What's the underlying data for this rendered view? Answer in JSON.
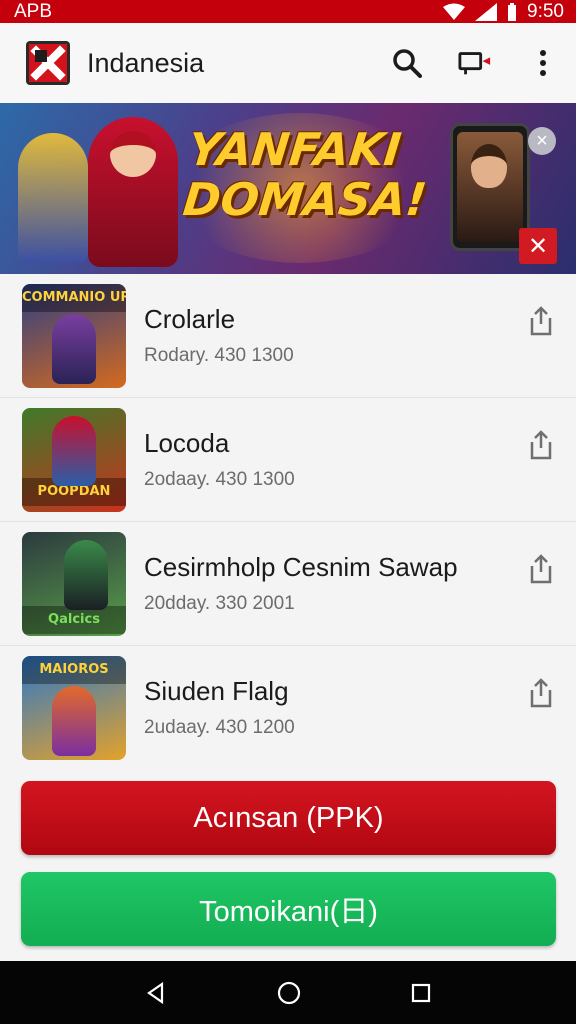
{
  "status_bar": {
    "carrier": "APB",
    "time": "9:50",
    "icons": [
      "wifi-icon",
      "signal-icon",
      "battery-icon"
    ]
  },
  "app_bar": {
    "title": "Indanesia",
    "icons": [
      "app-logo-icon",
      "search-icon",
      "cast-icon",
      "more-vert-icon"
    ]
  },
  "banner": {
    "headline_line1": "YANFAKI",
    "headline_line2": "DOMASA!",
    "close_grey": "×",
    "close_red": "✕"
  },
  "items": [
    {
      "name": "Crolarle",
      "sub": "Rodary. 430 1300",
      "thumb_text": "COMMANIO URUCAN",
      "thumb_colors": [
        "#2b3e86",
        "#d46a1e"
      ]
    },
    {
      "name": "Locoda",
      "sub": "2odaay. 430 1300",
      "thumb_text": "POOPDAN",
      "thumb_colors": [
        "#3e7a2a",
        "#c9321e"
      ]
    },
    {
      "name": "Cesirmholp Cesnim Sawap",
      "sub": "20dday. 330 2001",
      "thumb_text": "Qalcics",
      "thumb_colors": [
        "#2c3a3f",
        "#5aa04a"
      ]
    },
    {
      "name": "Siuden Flalg",
      "sub": "2udaay. 430 1200",
      "thumb_text": "MAIOROS",
      "thumb_colors": [
        "#2c77c9",
        "#e3a22a"
      ]
    }
  ],
  "buttons": {
    "primary": "Acınsan (PPK)",
    "secondary": "Tomoikani(日)"
  },
  "colors": {
    "status_bar": "#c4000c",
    "primary_button": "#c90e19",
    "secondary_button": "#19bb5c"
  }
}
